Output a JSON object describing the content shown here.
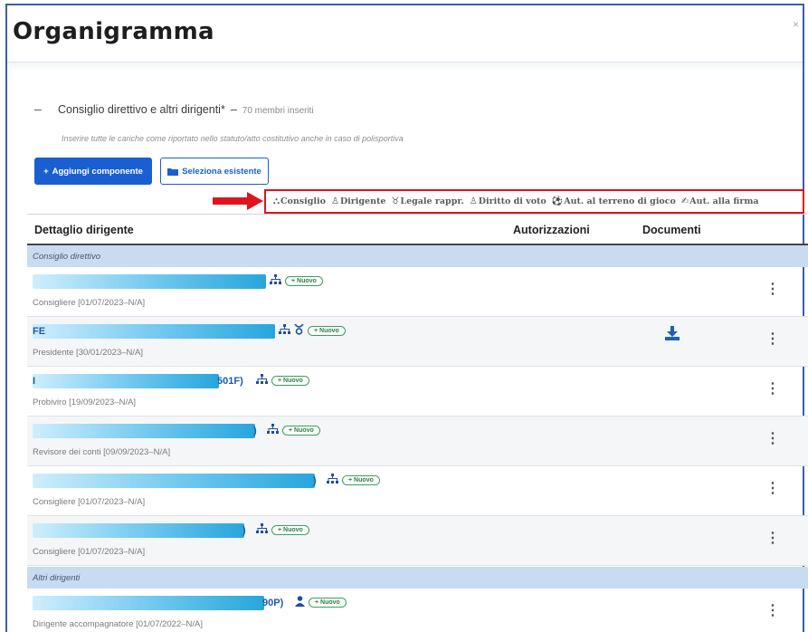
{
  "page": {
    "title": "Organigramma",
    "close_glyph": "×"
  },
  "section": {
    "collapse_glyph": "–",
    "title": "Consiglio direttivo e altri dirigenti*",
    "separator": "–",
    "count": "70 membri inseriti",
    "hint": "Inserire tutte le cariche come riportato nello statuto/atto costitutivo anche in caso di polisportiva"
  },
  "buttons": {
    "add": {
      "label": "Aggiungi componente",
      "icon": "plus-icon"
    },
    "select": {
      "label": "Seleziona esistente",
      "icon": "folder-icon"
    }
  },
  "legend": {
    "border_color": "#e0141c",
    "items": [
      {
        "icon": "sitemap-icon",
        "glyph": "⛬",
        "label": "Consiglio"
      },
      {
        "icon": "user-tie-icon",
        "glyph": "♙",
        "label": "Dirigente"
      },
      {
        "icon": "legal-icon",
        "glyph": "♉",
        "label": "Legale rappr."
      },
      {
        "icon": "users-icon",
        "glyph": "♙",
        "label": "Diritto di voto"
      },
      {
        "icon": "football-icon",
        "glyph": "⚽",
        "label": "Aut. al terreno di gioco"
      },
      {
        "icon": "signature-icon",
        "glyph": "✍",
        "label": "Aut. alla firma"
      }
    ]
  },
  "table": {
    "headers": {
      "detail": "Dettaglio dirigente",
      "auth": "Autorizzazioni",
      "docs": "Documenti"
    },
    "groups": {
      "board": "Consiglio direttivo",
      "others": "Altri dirigenti"
    },
    "new_label": "+ Nuovo",
    "rows": [
      {
        "prefix": "",
        "suffix": "",
        "icons": [
          "sitemap-icon"
        ],
        "role": "Consigliere [01/07/2023–N/A]",
        "download": false
      },
      {
        "prefix": "FE",
        "suffix": "",
        "icons": [
          "sitemap-icon",
          "legal-icon"
        ],
        "role": "Presidente [30/01/2023–N/A]",
        "download": true
      },
      {
        "prefix": "I",
        "suffix": "501F)",
        "icons": [
          "sitemap-icon"
        ],
        "role": "Probiviro [19/09/2023–N/A]",
        "download": false
      },
      {
        "prefix": "",
        "suffix": ")",
        "icons": [
          "sitemap-icon"
        ],
        "role": "Revisore dei conti [09/09/2023–N/A]",
        "download": false
      },
      {
        "prefix": "",
        "suffix": ")",
        "icons": [
          "sitemap-icon"
        ],
        "role": "Consigliere [01/07/2023–N/A]",
        "download": false
      },
      {
        "prefix": "",
        "suffix": ")",
        "icons": [
          "sitemap-icon"
        ],
        "role": "Consigliere [01/07/2023–N/A]",
        "download": false
      },
      {
        "prefix": "",
        "suffix": "90P)",
        "icons": [
          "user-tie-icon"
        ],
        "role": "Dirigente accompagnatore [01/07/2022–N/A]",
        "download": false
      }
    ]
  },
  "colors": {
    "primary": "#1a5fd1",
    "group_bg": "#c8dbf1",
    "new_border": "#38a15a",
    "accent_red": "#e0141c"
  }
}
